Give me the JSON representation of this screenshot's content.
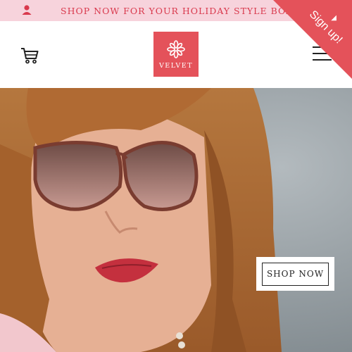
{
  "promo": {
    "text": "SHOP NOW FOR YOUR HOLIDAY STYLE BOX",
    "icon": "user-icon"
  },
  "header": {
    "cart_icon": "cart-icon",
    "logo_text": "VELVET",
    "menu_icon": "hamburger-menu-icon"
  },
  "signup": {
    "label": "Sign up!"
  },
  "hero": {
    "cta_label": "SHOP NOW"
  },
  "colors": {
    "brand": "#e4525a",
    "promo_bg": "#f7d3dc",
    "promo_text": "#d9394d"
  }
}
